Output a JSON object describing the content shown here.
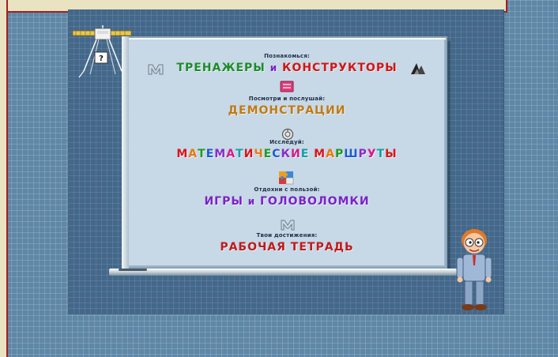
{
  "help": {
    "question_mark": "?"
  },
  "menu": [
    {
      "label": "Познакомься:",
      "title_parts": [
        "ТРЕНАЖЕРЫ",
        "и",
        "КОНСТРУКТОРЫ"
      ]
    },
    {
      "label": "Посмотри и послушай:",
      "title": "ДЕМОНСТРАЦИИ"
    },
    {
      "label": "Исследуй:",
      "title": "МАТЕМАТИЧЕСКИЕ МАРШРУТЫ"
    },
    {
      "label": "Отдохни с пользой:",
      "title_parts": [
        "ИГРЫ",
        "и",
        "ГОЛОВОЛОМКИ"
      ]
    },
    {
      "label": "Твои достижения:",
      "title": "РАБОЧАЯ ТЕТРАДЬ"
    }
  ],
  "colors": {
    "trainers": "#1c8c2a",
    "constructors": "#d11616",
    "demos": "#c07a14",
    "games": "#7a22c8",
    "workbook": "#c01a1a",
    "rainbow": [
      "#d8151b",
      "#e8780a",
      "#1f9a25",
      "#1d5ccf",
      "#8a2cc8",
      "#d61a8a",
      "#12a0a8"
    ]
  },
  "icons": [
    "satellite-icon",
    "question-icon",
    "m-logo-icon",
    "triangle-shapes-icon",
    "speaker-icon",
    "compass-icon",
    "puzzle-icon",
    "notebook-icon",
    "boy-character-icon"
  ]
}
